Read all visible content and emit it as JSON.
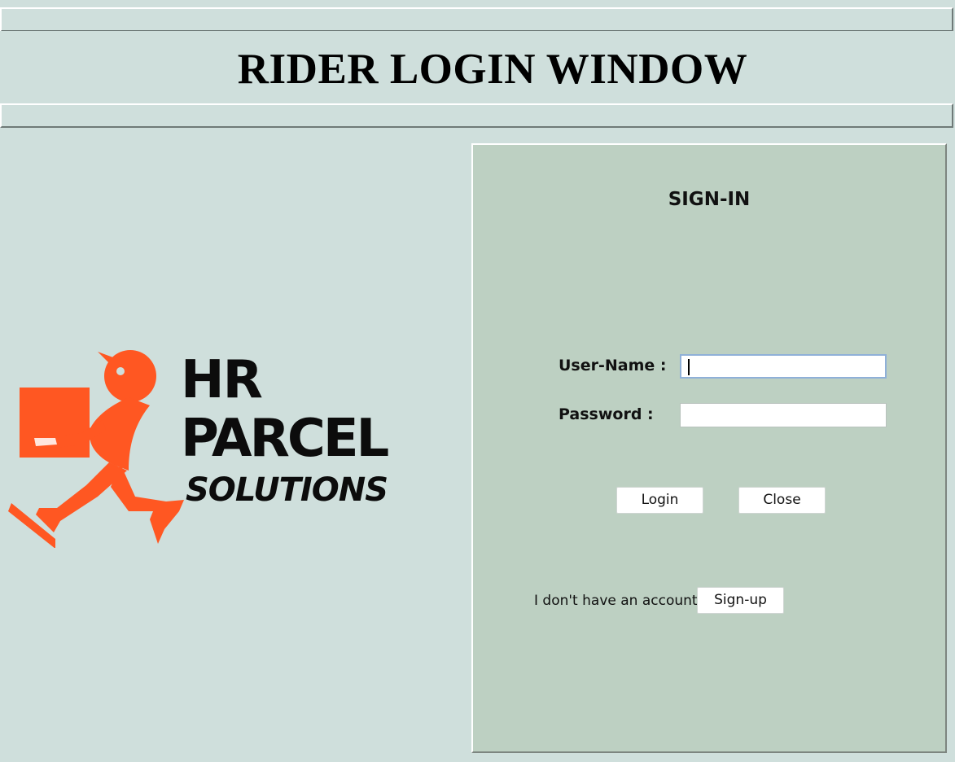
{
  "window": {
    "title": "RIDER LOGIN WINDOW"
  },
  "logo": {
    "line1": "HR",
    "line2": "PARCEL",
    "line3": "SOLUTIONS",
    "icon": "courier-running-with-box-icon",
    "icon_color": "#ff5722"
  },
  "signin": {
    "heading": "SIGN-IN",
    "username_label": "User-Name :",
    "username_value": "",
    "password_label": "Password :",
    "password_value": "",
    "login_button": "Login",
    "close_button": "Close",
    "no_account_text": "I don't have an account",
    "signup_button": "Sign-up"
  },
  "colors": {
    "background": "#cfdfdc",
    "panel": "#bdd0c2",
    "accent": "#ff5722"
  }
}
